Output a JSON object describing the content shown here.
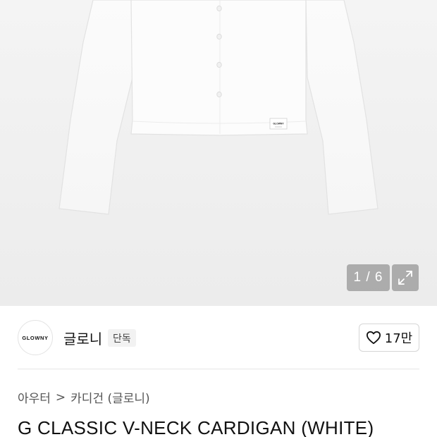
{
  "gallery": {
    "pager": "1 / 6",
    "garment_label": "GLOWNY",
    "icons": {
      "expand": "expand-icon"
    }
  },
  "brand": {
    "logo_text": "GLOWNY",
    "name": "글로니",
    "tag": "단독",
    "like_count": "17만",
    "icons": {
      "like": "heart-outline-icon"
    }
  },
  "breadcrumb": {
    "items": [
      "아우터",
      "카디건 (글로니)"
    ],
    "separator": ">"
  },
  "product": {
    "title": "G CLASSIC V-NECK CARDIGAN (WHITE)"
  }
}
